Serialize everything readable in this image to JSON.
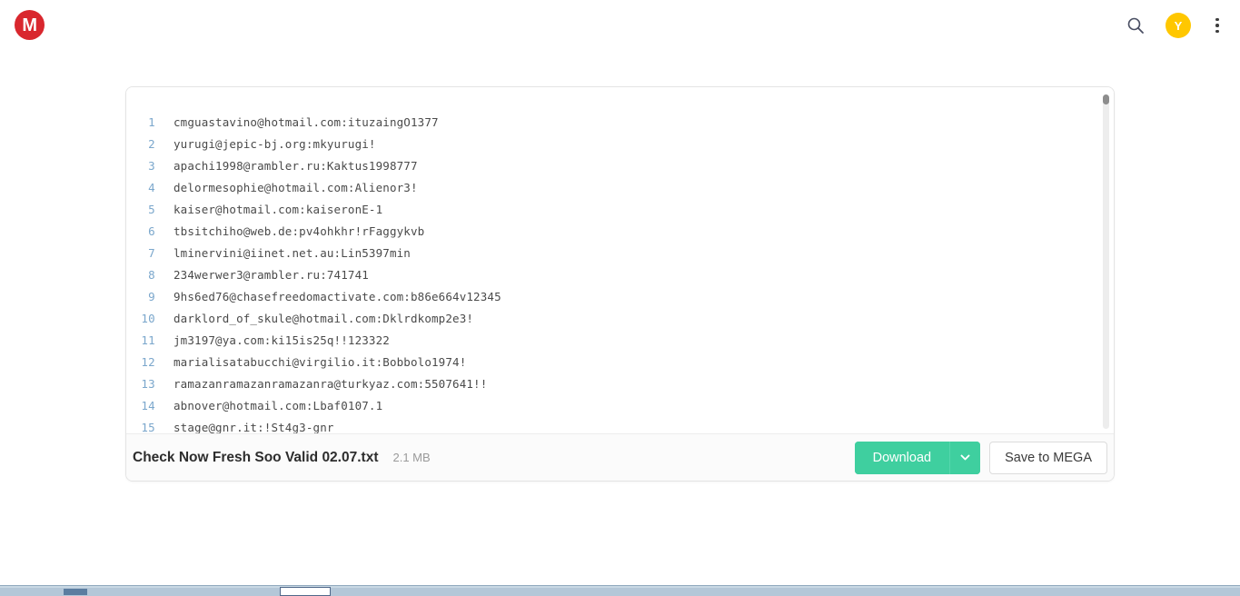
{
  "topbar": {
    "logo_letter": "M",
    "logo_name": "mega-logo",
    "logo_color": "#d9272e",
    "search_icon": "search-icon",
    "avatar_letter": "Y",
    "avatar_color": "#ffc700",
    "menu_icon": "kebab-menu-icon"
  },
  "preview": {
    "lines": [
      {
        "n": "1",
        "text": "cmguastavino@hotmail.com:ituzaingO1377"
      },
      {
        "n": "2",
        "text": "yurugi@jepic-bj.org:mkyurugi!"
      },
      {
        "n": "3",
        "text": "apachi1998@rambler.ru:Kaktus1998777"
      },
      {
        "n": "4",
        "text": "delormesophie@hotmail.com:Alienor3!"
      },
      {
        "n": "5",
        "text": "kaiser@hotmail.com:kaiseronE-1"
      },
      {
        "n": "6",
        "text": "tbsitchiho@web.de:pv4ohkhr!rFaggykvb"
      },
      {
        "n": "7",
        "text": "lminervini@iinet.net.au:Lin5397min"
      },
      {
        "n": "8",
        "text": "234werwer3@rambler.ru:741741"
      },
      {
        "n": "9",
        "text": "9hs6ed76@chasefreedomactivate.com:b86e664v12345"
      },
      {
        "n": "10",
        "text": "darklord_of_skule@hotmail.com:Dklrdkomp2e3!"
      },
      {
        "n": "11",
        "text": "jm3197@ya.com:ki15is25q!!123322"
      },
      {
        "n": "12",
        "text": "marialisatabucchi@virgilio.it:Bobbolo1974!"
      },
      {
        "n": "13",
        "text": "ramazanramazanramazanra@turkyaz.com:5507641!!"
      },
      {
        "n": "14",
        "text": "abnover@hotmail.com:Lbaf0107.1"
      },
      {
        "n": "15",
        "text": "stage@gnr.it:!St4g3-gnr"
      }
    ]
  },
  "footer": {
    "file_name": "Check Now Fresh Soo Valid 02.07.txt",
    "file_size": "2.1 MB",
    "download_label": "Download",
    "download_color": "#3fcf9f",
    "download_caret_icon": "chevron-down-icon",
    "save_label": "Save to MEGA"
  }
}
